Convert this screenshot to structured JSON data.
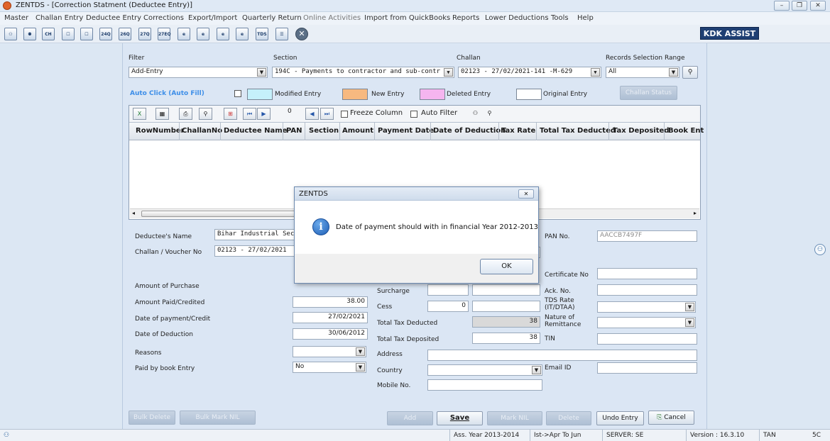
{
  "window": {
    "title": "ZENTDS - [Correction Statment (Deductee Entry)]",
    "controls": [
      "–",
      "❐",
      "✕"
    ]
  },
  "menu": [
    "Master",
    "Challan Entry",
    "Deductee Entry",
    "Corrections",
    "Export/Import",
    "Quarterly Return",
    "Online Activities",
    "Import from QuickBooks",
    "Reports",
    "Lower Deductions",
    "Tools",
    "Help"
  ],
  "toolbar": {
    "icons": [
      "users-icon",
      "group-icon",
      "ch-icon",
      "form-icon",
      "form2-icon",
      "24q-icon",
      "26q-icon",
      "27q-icon",
      "27eq-icon",
      "e-24q-icon",
      "e-26q-icon",
      "e-27q-icon",
      "e-27eq-icon",
      "tds-icon",
      "notes-icon",
      "close-icon"
    ],
    "icon_labels": [
      "⚇",
      "⚉",
      "CH",
      "☐",
      "☐",
      "24Q",
      "26Q",
      "27Q",
      "27EQ",
      "e",
      "e",
      "e",
      "e",
      "TDS",
      "☰",
      "✕"
    ],
    "kdk_assist": "KDK ASSIST"
  },
  "filter": {
    "filter_label": "Filter",
    "filter_value": "Add-Entry",
    "section_label": "Section",
    "section_value": "194C     - Payments to contractor and sub-contr",
    "challan_label": "Challan",
    "challan_value": "02123     - 27/02/2021-141 -M-629",
    "range_label": "Records Selection Range",
    "range_value": "All"
  },
  "legend": {
    "auto_click": "Auto Click (Auto Fill)",
    "modified": "Modified Entry",
    "new": "New Entry",
    "deleted": "Deleted Entry",
    "original": "Original Entry",
    "challan_status": "Challan Status",
    "colors": {
      "modified": "#c5f0fb",
      "new": "#f7b980",
      "deleted": "#f5b5ef",
      "original": "#ffffff"
    }
  },
  "grid_toolbar": {
    "counter": "0",
    "freeze_column": "Freeze Column",
    "auto_filter": "Auto Filter"
  },
  "grid": {
    "columns": [
      "RowNumber",
      "ChallanNo",
      "Deductee Name",
      "PAN",
      "Section",
      "Amount",
      "Payment Date",
      "Date of Deduction",
      "Tax Rate",
      "Total Tax Deducted",
      "Tax Deposited",
      "Book Ent"
    ]
  },
  "form": {
    "deductee_name_label": "Deductee's Name",
    "deductee_name_value": "Bihar Industrial Securi",
    "challan_voucher_label": "Challan / Voucher No",
    "challan_voucher_value": "02123     - 27/02/2021",
    "pan_label": "PAN No.",
    "pan_value": "AACCB7497F",
    "amount_purchase_label": "Amount of Purchase",
    "amount_paid_label": "Amount Paid/Credited",
    "amount_paid_value": "38.00",
    "date_payment_label": "Date of payment/Credit",
    "date_payment_value": "27/02/2021",
    "date_deduction_label": "Date of Deduction",
    "date_deduction_value": "30/06/2012",
    "reasons_label": "Reasons",
    "paid_book_label": "Paid by book Entry",
    "paid_book_value": "No",
    "surcharge_label": "Surcharge",
    "cess_label": "Cess",
    "cess_value": "0",
    "total_deducted_label": "Total Tax Deducted",
    "total_deducted_value": "38",
    "total_deposited_label": "Total Tax Deposited",
    "total_deposited_value": "38",
    "address_label": "Address",
    "country_label": "Country",
    "mobile_label": "Mobile No.",
    "certificate_label": "Certificate No",
    "ack_label": "Ack. No.",
    "tds_rate_label_1": "TDS Rate",
    "tds_rate_label_2": "(IT/DTAA)",
    "nature_label_1": "Nature of",
    "nature_label_2": "Remittance",
    "tin_label": "TIN",
    "email_label": "Email ID"
  },
  "buttons": {
    "bulk_delete": "Bulk Delete",
    "bulk_mark_nil": "Bulk Mark NIL",
    "add": "Add",
    "save": "Save",
    "mark_nil": "Mark NIL",
    "delete": "Delete",
    "undo_entry": "Undo Entry",
    "cancel": "Cancel"
  },
  "dialog": {
    "title": "ZENTDS",
    "message": "Date of payment should with in financial Year 2012-2013",
    "ok": "OK",
    "close": "✕"
  },
  "statusbar": {
    "ass_year": "Ass. Year 2013-2014",
    "quarter": "Ist->Apr To Jun",
    "server": "SERVER: SE",
    "version": "Version : 16.3.10",
    "tan": "TAN",
    "tan_suffix": "5C"
  }
}
